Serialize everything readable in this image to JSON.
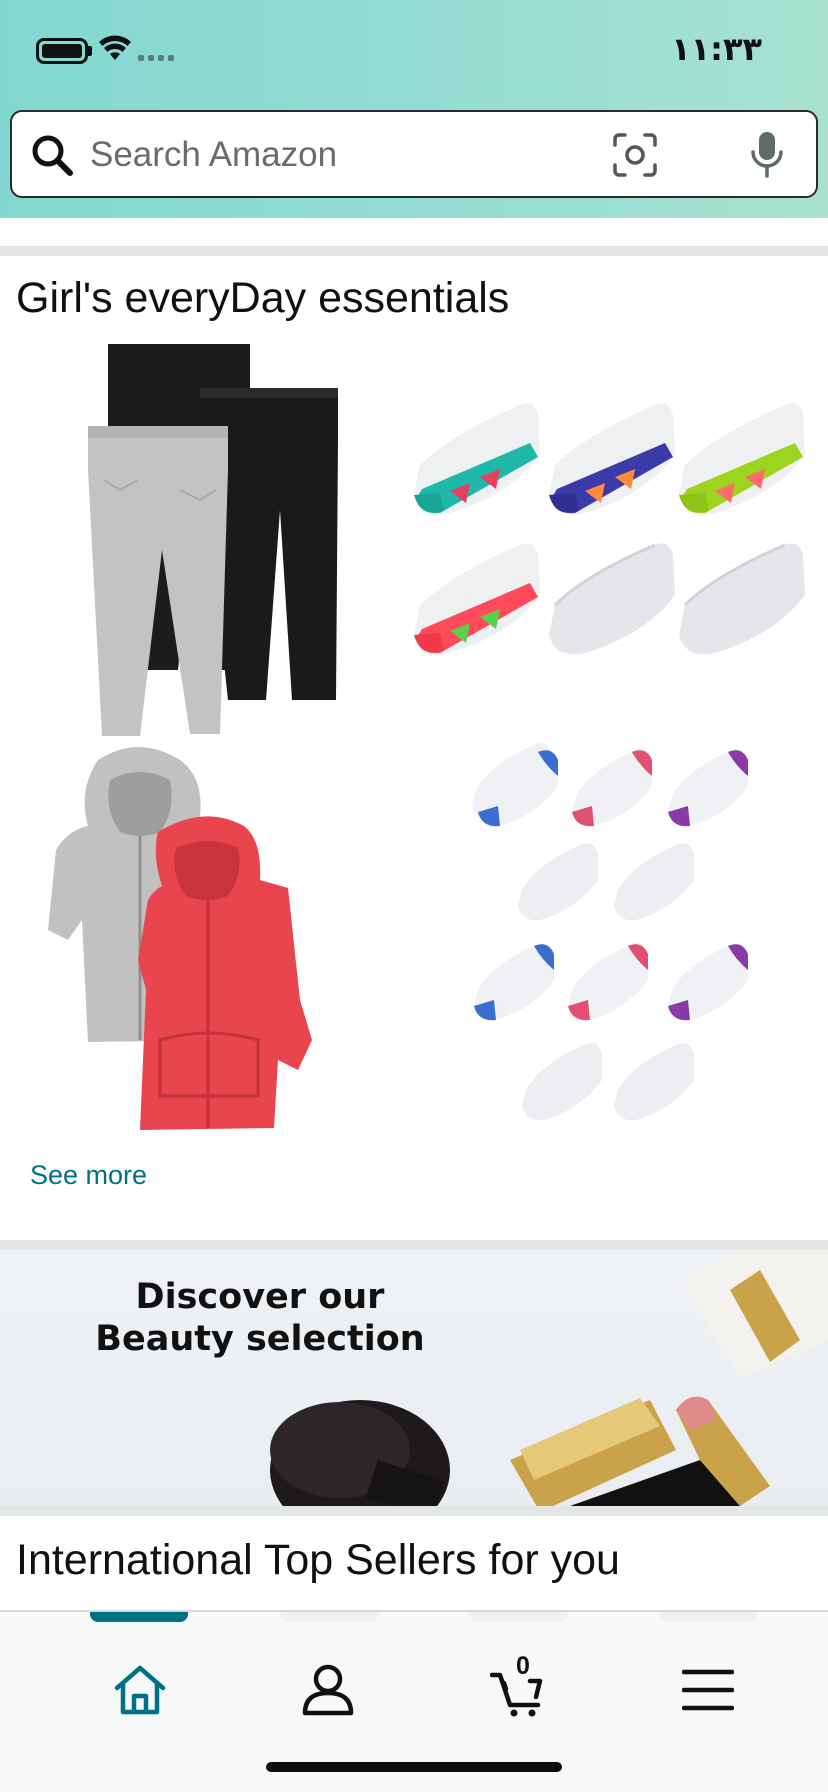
{
  "status_bar": {
    "time": "١١:٣٣"
  },
  "search": {
    "placeholder": "Search Amazon"
  },
  "card1": {
    "title": "Girl's everyDay essentials",
    "see_more": "See more"
  },
  "banner": {
    "line1": "Discover our",
    "line2": "Beauty selection"
  },
  "card2": {
    "title": "International Top Sellers for you"
  },
  "bottom_nav": {
    "cart_count": "0",
    "active_color": "#007185"
  },
  "colors": {
    "header_gradient_start": "#82d8d0",
    "header_gradient_end": "#a8e2cf",
    "link": "#007185",
    "accent": "#007185"
  }
}
